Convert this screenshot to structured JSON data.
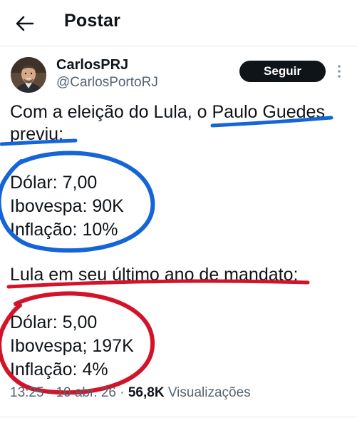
{
  "header": {
    "title": "Postar"
  },
  "author": {
    "display_name": "CarlosPRJ",
    "handle": "@CarlosPortoRJ",
    "follow_label": "Seguir"
  },
  "tweet": {
    "lines": [
      "Com a eleição do Lula, o Paulo Guedes",
      "previu:",
      "Dólar: 7,00",
      "Ibovespa: 90K",
      "Inflação: 10%",
      "Lula em seu último ano de mandato:",
      "Dólar: 5,00",
      "Ibovespa; 197K",
      "Inflação: 4%"
    ]
  },
  "meta": {
    "time": "13:25",
    "separator": "·",
    "date": "10 abr. 26",
    "views_count": "56,8K",
    "views_label": "Visualizações"
  },
  "annotation_colors": {
    "blue": "#1565d8",
    "red": "#d3132a"
  },
  "icons": {
    "back": "arrow-left-icon",
    "more": "more-vertical-icon"
  }
}
